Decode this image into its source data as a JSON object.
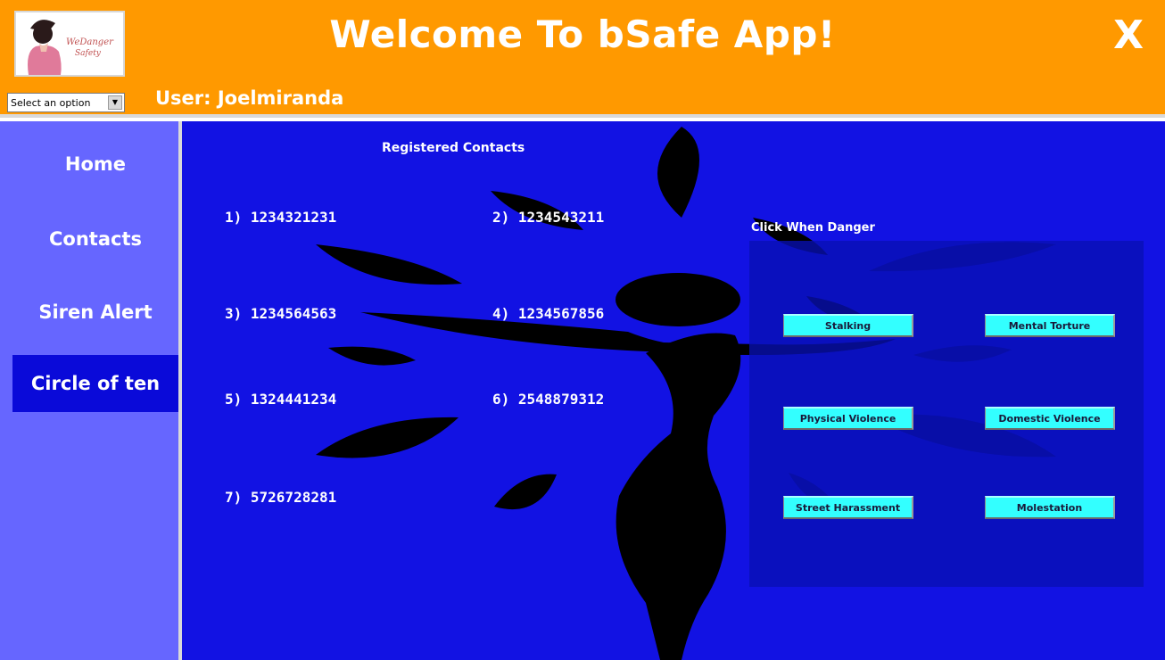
{
  "app": {
    "title": "Welcome To bSafe App!",
    "close_label": "X",
    "user_label": "User: Joelmiranda",
    "dropdown": {
      "selected": "Select an option"
    }
  },
  "sidebar": {
    "items": [
      {
        "label": "Home"
      },
      {
        "label": "Contacts"
      },
      {
        "label": "Siren Alert"
      },
      {
        "label": "Circle of ten",
        "active": true
      }
    ]
  },
  "main": {
    "registered_title": "Registered Contacts",
    "contacts": [
      "1) 1234321231",
      "2) 1234543211",
      "3) 1234564563",
      "4) 1234567856",
      "5) 1324441234",
      "6) 2548879312",
      "7) 5726728281"
    ],
    "danger": {
      "title": "Click When Danger",
      "buttons": [
        "Stalking",
        "Mental Torture",
        "Physical Violence",
        "Domestic Violence",
        "Street Harassment",
        "Molestation"
      ]
    }
  },
  "colors": {
    "header": "#ff9900",
    "sidebar": "#6666ff",
    "sidebar_active": "#0a0ad9",
    "main": "#1212e3",
    "danger_button": "#33ffff"
  }
}
